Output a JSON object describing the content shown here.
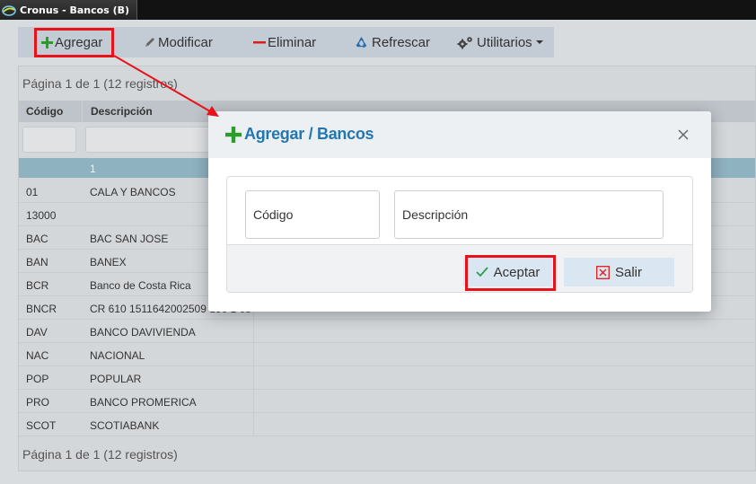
{
  "window": {
    "title": "Cronus - Bancos (B)"
  },
  "toolbar": {
    "add_label": "Agregar",
    "edit_label": "Modificar",
    "delete_label": "Eliminar",
    "refresh_label": "Refrescar",
    "utils_label": "Utilitarios"
  },
  "grid": {
    "pager_top": "Página 1 de 1 (12 registros)",
    "pager_bottom": "Página 1 de 1 (12 registros)",
    "columns": {
      "code": "Código",
      "description": "Descripción"
    },
    "selected_row_desc": "1",
    "rows": [
      {
        "code": "01",
        "description": "CALA Y BANCOS"
      },
      {
        "code": "13000",
        "description": ""
      },
      {
        "code": "BAC",
        "description": "BAC SAN JOSE"
      },
      {
        "code": "BAN",
        "description": "BANEX"
      },
      {
        "code": "BCR",
        "description": "Banco de Costa Rica"
      },
      {
        "code": "BNCR",
        "description": "CR 610 1511642002509 150 1 05"
      },
      {
        "code": "DAV",
        "description": "BANCO DAVIVIENDA"
      },
      {
        "code": "NAC",
        "description": "NACIONAL"
      },
      {
        "code": "POP",
        "description": "POPULAR"
      },
      {
        "code": "PRO",
        "description": "BANCO PROMERICA"
      },
      {
        "code": "SCOT",
        "description": "SCOTIABANK"
      }
    ]
  },
  "modal": {
    "title": "Agregar / Bancos",
    "code_placeholder": "Código",
    "description_placeholder": "Descripción",
    "accept_label": "Aceptar",
    "exit_label": "Salir"
  },
  "colors": {
    "accent_title": "#2277b1",
    "add_icon": "#2a9d2a",
    "delete_icon": "#d9201f",
    "highlight": "#e8121b",
    "selected_row": "#8fb2c1"
  },
  "icons": {
    "add": "plus-icon",
    "edit": "pencil-icon",
    "delete": "minus-icon",
    "refresh": "recycle-icon",
    "utils": "gears-icon",
    "close": "close-icon",
    "accept": "check-icon",
    "exit": "x-box-icon"
  }
}
